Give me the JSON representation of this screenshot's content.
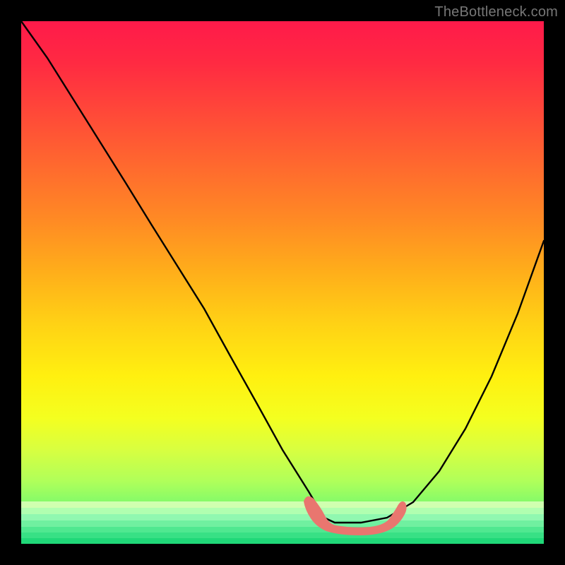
{
  "watermark": "TheBottleneck.com",
  "colors": {
    "background": "#000000",
    "curve": "#000000",
    "valley_highlight": "#e9766f",
    "watermark_text": "#777777"
  },
  "chart_data": {
    "type": "line",
    "title": "",
    "xlabel": "",
    "ylabel": "",
    "xlim": [
      0,
      100
    ],
    "ylim": [
      0,
      100
    ],
    "grid": false,
    "series": [
      {
        "name": "bottleneck-curve",
        "x": [
          0,
          5,
          10,
          15,
          20,
          25,
          30,
          35,
          40,
          45,
          50,
          55,
          58,
          60,
          62,
          65,
          70,
          75,
          80,
          85,
          90,
          95,
          100
        ],
        "values": [
          100,
          93,
          85,
          77,
          69,
          61,
          53,
          45,
          36,
          27,
          18,
          10,
          5,
          4,
          4,
          4,
          5,
          8,
          14,
          22,
          32,
          44,
          58
        ]
      }
    ],
    "annotations": [
      {
        "name": "valley-highlight",
        "x_range": [
          55,
          72
        ],
        "y": 4,
        "color": "#e9766f"
      }
    ],
    "bottom_bands": [
      "#c8ff9a",
      "#a8ffa8",
      "#88f8b0",
      "#60f0a0",
      "#40e890",
      "#30e080",
      "#20d878"
    ]
  }
}
